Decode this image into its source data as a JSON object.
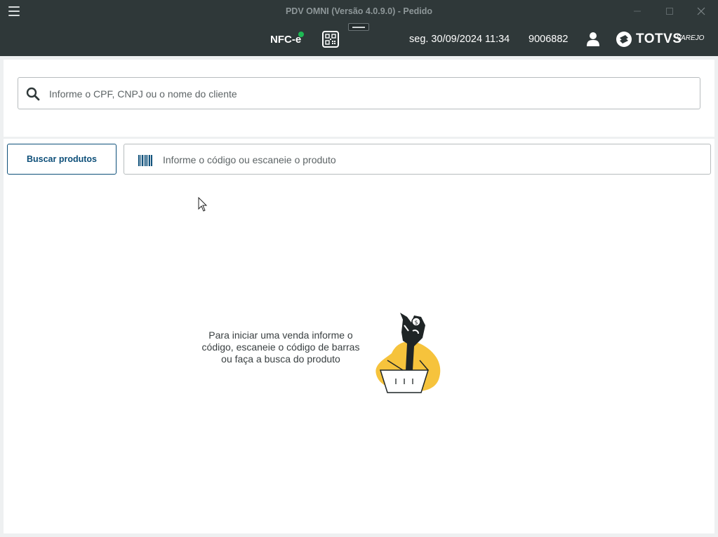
{
  "window": {
    "title": "PDV OMNI (Versão 4.0.9.0) - Pedido"
  },
  "header": {
    "fiscal_label": "NFC-e",
    "datetime": "seg. 30/09/2024 11:34",
    "operator_code": "9006882",
    "brand_name": "TOTVS",
    "brand_sub": "VAREJO",
    "status_color": "#1db954"
  },
  "client_search": {
    "placeholder": "Informe o CPF, CNPJ ou o nome do cliente",
    "value": ""
  },
  "product": {
    "buscar_label": "Buscar produtos",
    "placeholder": "Informe o código ou escaneie o produto",
    "value": ""
  },
  "empty_state": {
    "message": "Para iniciar uma venda informe o código, escaneie o código de barras ou faça a busca do produto"
  },
  "colors": {
    "header_bg": "#2f3839",
    "accent": "#0d4f79",
    "illustration_blob": "#f6c33c"
  }
}
